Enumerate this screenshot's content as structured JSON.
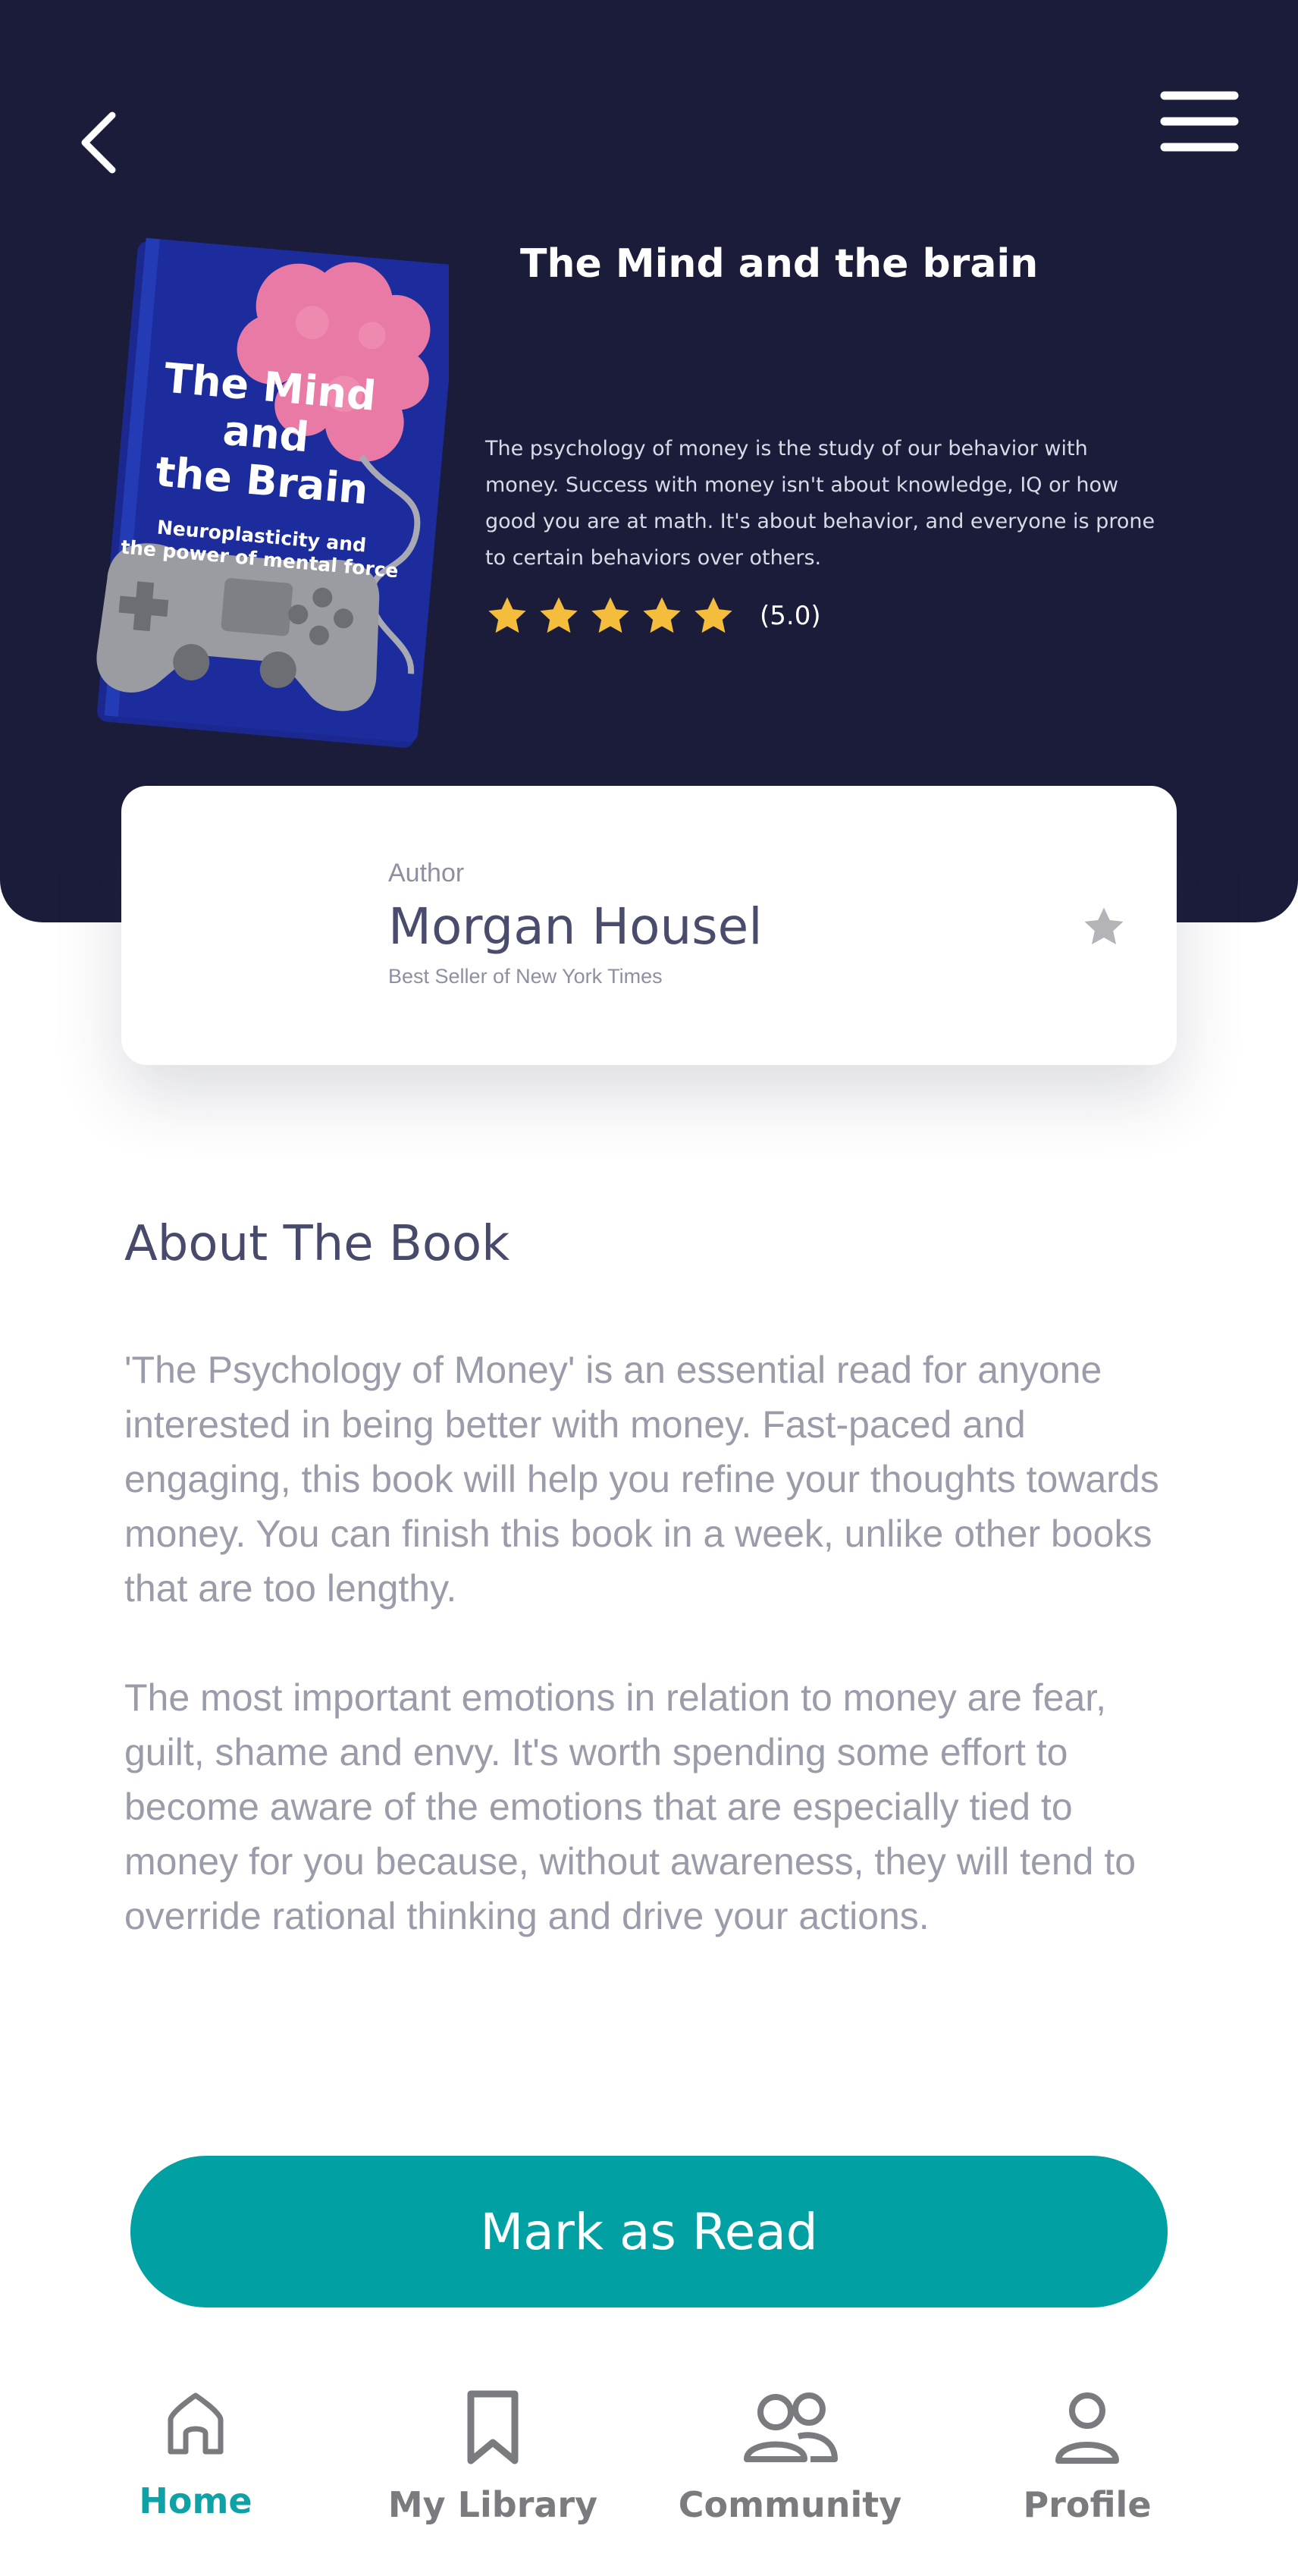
{
  "header": {
    "back_icon": "chevron-left-icon",
    "menu_icon": "hamburger-menu-icon"
  },
  "book": {
    "title": "The Mind and the brain",
    "description": "The psychology of money is the study of our behavior with money. Success with money isn't about knowledge, IQ or how good you are at math. It's about behavior, and everyone is prone to certain behaviors over others.",
    "rating_value": "(5.0)",
    "rating_stars": 5,
    "cover": {
      "title_line1": "The Mind",
      "title_line2": "and",
      "title_line3": "the Brain",
      "subtitle_line1": "Neuroplasticity and",
      "subtitle_line2": "the power of mental force",
      "background_color": "#1c2c9c",
      "brain_color": "#e97aa6"
    }
  },
  "author": {
    "label": "Author",
    "name": "Morgan Housel",
    "subtitle": "Best Seller of New York Times",
    "favorite_icon": "star-icon"
  },
  "about": {
    "title": "About The Book",
    "paragraph1": "'The Psychology of Money' is an essential read for anyone interested in being better with money. Fast-paced and engaging, this book will help you refine your thoughts towards money. You can finish this book in a week, unlike other books that are too lengthy.",
    "paragraph2": "The most important emotions in relation to money are fear, guilt, shame and envy. It's worth spending some effort to become aware of the emotions that are especially tied to money for you because, without awareness, they will tend to override rational thinking and drive your actions."
  },
  "actions": {
    "mark_read_label": "Mark as Read"
  },
  "nav": {
    "items": [
      {
        "label": "Home",
        "icon": "home-icon",
        "active": true
      },
      {
        "label": "My Library",
        "icon": "bookmark-icon",
        "active": false
      },
      {
        "label": "Community",
        "icon": "community-icon",
        "active": false
      },
      {
        "label": "Profile",
        "icon": "profile-icon",
        "active": false
      }
    ]
  },
  "colors": {
    "header_bg": "#1b1c3a",
    "accent": "#00a0a3",
    "star": "#f5bd3c",
    "text_dark": "#484a6c",
    "text_muted": "#9b9caa"
  }
}
